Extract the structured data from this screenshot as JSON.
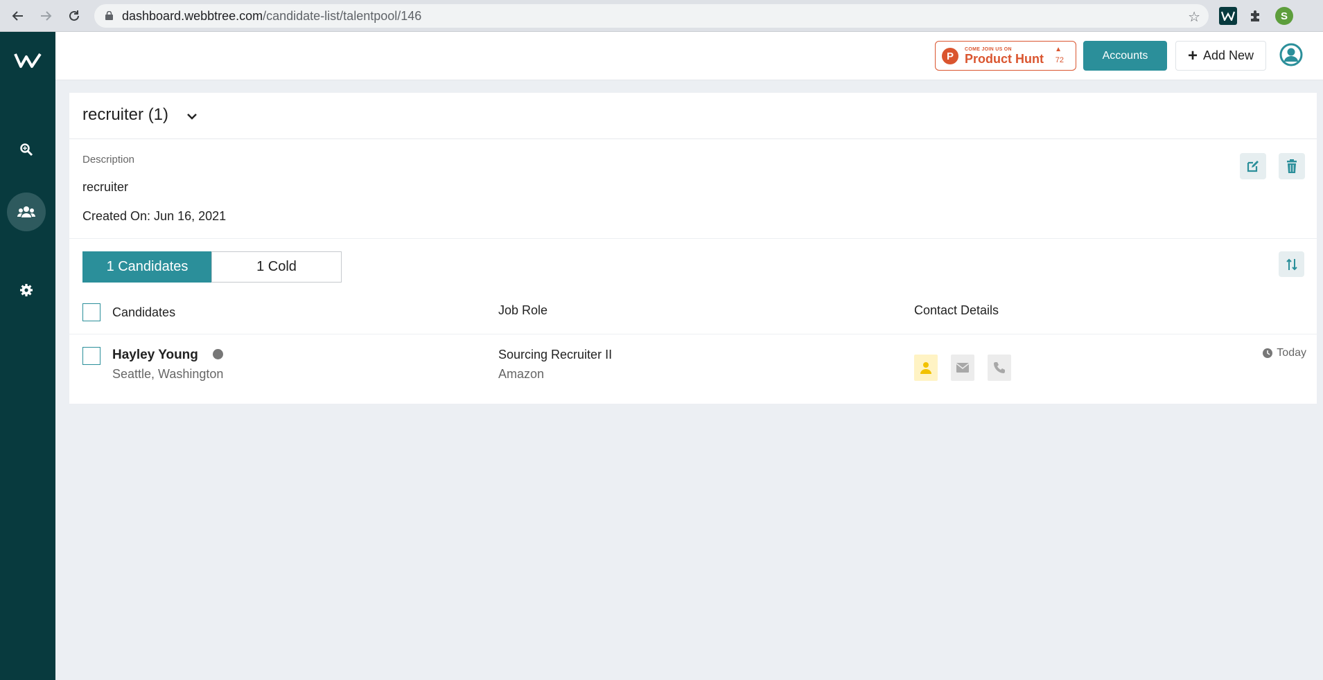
{
  "browser": {
    "url_host": "dashboard.webbtree.com",
    "url_path": "/candidate-list/talentpool/146",
    "profile_initial": "S"
  },
  "header": {
    "producthunt_small": "COME JOIN US ON",
    "producthunt_name": "Product Hunt",
    "producthunt_count": "72",
    "accounts_label": "Accounts",
    "add_new_label": "Add New"
  },
  "pool": {
    "title": "recruiter (1)",
    "description_label": "Description",
    "description": "recruiter",
    "created_on": "Created On: Jun 16, 2021"
  },
  "tabs": [
    {
      "label": "1 Candidates",
      "active": true
    },
    {
      "label": "1 Cold",
      "active": false
    }
  ],
  "table": {
    "columns": {
      "candidates": "Candidates",
      "job_role": "Job Role",
      "contact": "Contact Details"
    },
    "rows": [
      {
        "name": "Hayley  Young",
        "location": "Seattle, Washington",
        "job_title": "Sourcing Recruiter II",
        "company": "Amazon",
        "time": "Today"
      }
    ]
  },
  "colors": {
    "sidebar": "#083a3e",
    "accent": "#2b8f9a",
    "producthunt": "#da552f",
    "contact_profile_bg": "#fff3c4"
  }
}
